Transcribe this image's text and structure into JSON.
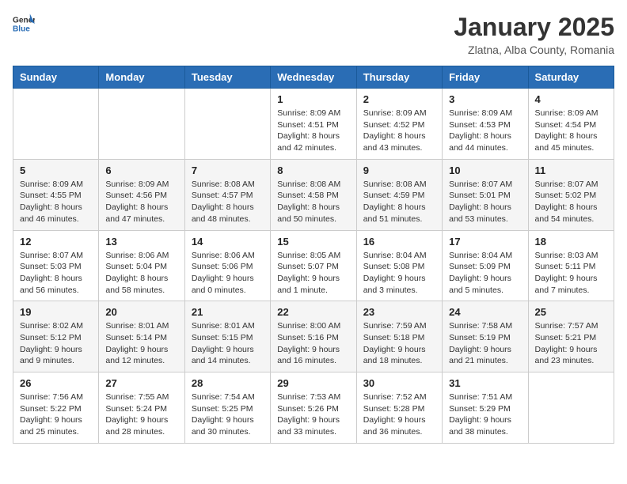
{
  "header": {
    "logo_general": "General",
    "logo_blue": "Blue",
    "title": "January 2025",
    "subtitle": "Zlatna, Alba County, Romania"
  },
  "days_of_week": [
    "Sunday",
    "Monday",
    "Tuesday",
    "Wednesday",
    "Thursday",
    "Friday",
    "Saturday"
  ],
  "weeks": [
    [
      {
        "day": "",
        "info": ""
      },
      {
        "day": "",
        "info": ""
      },
      {
        "day": "",
        "info": ""
      },
      {
        "day": "1",
        "info": "Sunrise: 8:09 AM\nSunset: 4:51 PM\nDaylight: 8 hours and 42 minutes."
      },
      {
        "day": "2",
        "info": "Sunrise: 8:09 AM\nSunset: 4:52 PM\nDaylight: 8 hours and 43 minutes."
      },
      {
        "day": "3",
        "info": "Sunrise: 8:09 AM\nSunset: 4:53 PM\nDaylight: 8 hours and 44 minutes."
      },
      {
        "day": "4",
        "info": "Sunrise: 8:09 AM\nSunset: 4:54 PM\nDaylight: 8 hours and 45 minutes."
      }
    ],
    [
      {
        "day": "5",
        "info": "Sunrise: 8:09 AM\nSunset: 4:55 PM\nDaylight: 8 hours and 46 minutes."
      },
      {
        "day": "6",
        "info": "Sunrise: 8:09 AM\nSunset: 4:56 PM\nDaylight: 8 hours and 47 minutes."
      },
      {
        "day": "7",
        "info": "Sunrise: 8:08 AM\nSunset: 4:57 PM\nDaylight: 8 hours and 48 minutes."
      },
      {
        "day": "8",
        "info": "Sunrise: 8:08 AM\nSunset: 4:58 PM\nDaylight: 8 hours and 50 minutes."
      },
      {
        "day": "9",
        "info": "Sunrise: 8:08 AM\nSunset: 4:59 PM\nDaylight: 8 hours and 51 minutes."
      },
      {
        "day": "10",
        "info": "Sunrise: 8:07 AM\nSunset: 5:01 PM\nDaylight: 8 hours and 53 minutes."
      },
      {
        "day": "11",
        "info": "Sunrise: 8:07 AM\nSunset: 5:02 PM\nDaylight: 8 hours and 54 minutes."
      }
    ],
    [
      {
        "day": "12",
        "info": "Sunrise: 8:07 AM\nSunset: 5:03 PM\nDaylight: 8 hours and 56 minutes."
      },
      {
        "day": "13",
        "info": "Sunrise: 8:06 AM\nSunset: 5:04 PM\nDaylight: 8 hours and 58 minutes."
      },
      {
        "day": "14",
        "info": "Sunrise: 8:06 AM\nSunset: 5:06 PM\nDaylight: 9 hours and 0 minutes."
      },
      {
        "day": "15",
        "info": "Sunrise: 8:05 AM\nSunset: 5:07 PM\nDaylight: 9 hours and 1 minute."
      },
      {
        "day": "16",
        "info": "Sunrise: 8:04 AM\nSunset: 5:08 PM\nDaylight: 9 hours and 3 minutes."
      },
      {
        "day": "17",
        "info": "Sunrise: 8:04 AM\nSunset: 5:09 PM\nDaylight: 9 hours and 5 minutes."
      },
      {
        "day": "18",
        "info": "Sunrise: 8:03 AM\nSunset: 5:11 PM\nDaylight: 9 hours and 7 minutes."
      }
    ],
    [
      {
        "day": "19",
        "info": "Sunrise: 8:02 AM\nSunset: 5:12 PM\nDaylight: 9 hours and 9 minutes."
      },
      {
        "day": "20",
        "info": "Sunrise: 8:01 AM\nSunset: 5:14 PM\nDaylight: 9 hours and 12 minutes."
      },
      {
        "day": "21",
        "info": "Sunrise: 8:01 AM\nSunset: 5:15 PM\nDaylight: 9 hours and 14 minutes."
      },
      {
        "day": "22",
        "info": "Sunrise: 8:00 AM\nSunset: 5:16 PM\nDaylight: 9 hours and 16 minutes."
      },
      {
        "day": "23",
        "info": "Sunrise: 7:59 AM\nSunset: 5:18 PM\nDaylight: 9 hours and 18 minutes."
      },
      {
        "day": "24",
        "info": "Sunrise: 7:58 AM\nSunset: 5:19 PM\nDaylight: 9 hours and 21 minutes."
      },
      {
        "day": "25",
        "info": "Sunrise: 7:57 AM\nSunset: 5:21 PM\nDaylight: 9 hours and 23 minutes."
      }
    ],
    [
      {
        "day": "26",
        "info": "Sunrise: 7:56 AM\nSunset: 5:22 PM\nDaylight: 9 hours and 25 minutes."
      },
      {
        "day": "27",
        "info": "Sunrise: 7:55 AM\nSunset: 5:24 PM\nDaylight: 9 hours and 28 minutes."
      },
      {
        "day": "28",
        "info": "Sunrise: 7:54 AM\nSunset: 5:25 PM\nDaylight: 9 hours and 30 minutes."
      },
      {
        "day": "29",
        "info": "Sunrise: 7:53 AM\nSunset: 5:26 PM\nDaylight: 9 hours and 33 minutes."
      },
      {
        "day": "30",
        "info": "Sunrise: 7:52 AM\nSunset: 5:28 PM\nDaylight: 9 hours and 36 minutes."
      },
      {
        "day": "31",
        "info": "Sunrise: 7:51 AM\nSunset: 5:29 PM\nDaylight: 9 hours and 38 minutes."
      },
      {
        "day": "",
        "info": ""
      }
    ]
  ]
}
